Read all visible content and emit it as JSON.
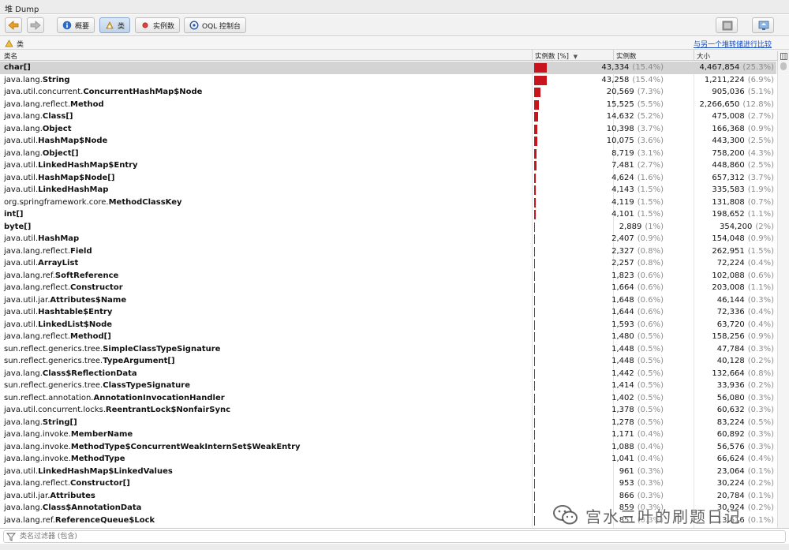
{
  "window": {
    "title": "堆 Dump"
  },
  "toolbar": {
    "buttons": [
      {
        "label": "概要"
      },
      {
        "label": "类"
      },
      {
        "label": "实例数"
      },
      {
        "label": "OQL 控制台"
      }
    ]
  },
  "panel": {
    "title": "类",
    "compare_link": "与另一个堆转储进行比较"
  },
  "table": {
    "headers": {
      "name": "类名",
      "instances_pct": "实例数 [%]",
      "instances": "实例数",
      "size": "大小"
    },
    "rows": [
      {
        "pkg": "",
        "cls": "char[]",
        "count": "43,334",
        "count_pct": "(15.4%)",
        "size": "4,467,854",
        "size_pct": "(25.3%)",
        "ratio": 1.0,
        "selected": true
      },
      {
        "pkg": "java.lang.",
        "cls": "String",
        "count": "43,258",
        "count_pct": "(15.4%)",
        "size": "1,211,224",
        "size_pct": "(6.9%)",
        "ratio": 0.998
      },
      {
        "pkg": "java.util.concurrent.",
        "cls": "ConcurrentHashMap$Node",
        "count": "20,569",
        "count_pct": "(7.3%)",
        "size": "905,036",
        "size_pct": "(5.1%)",
        "ratio": 0.475
      },
      {
        "pkg": "java.lang.reflect.",
        "cls": "Method",
        "count": "15,525",
        "count_pct": "(5.5%)",
        "size": "2,266,650",
        "size_pct": "(12.8%)",
        "ratio": 0.358
      },
      {
        "pkg": "java.lang.",
        "cls": "Class[]",
        "count": "14,632",
        "count_pct": "(5.2%)",
        "size": "475,008",
        "size_pct": "(2.7%)",
        "ratio": 0.338
      },
      {
        "pkg": "java.lang.",
        "cls": "Object",
        "count": "10,398",
        "count_pct": "(3.7%)",
        "size": "166,368",
        "size_pct": "(0.9%)",
        "ratio": 0.24
      },
      {
        "pkg": "java.util.",
        "cls": "HashMap$Node",
        "count": "10,075",
        "count_pct": "(3.6%)",
        "size": "443,300",
        "size_pct": "(2.5%)",
        "ratio": 0.232
      },
      {
        "pkg": "java.lang.",
        "cls": "Object[]",
        "count": "8,719",
        "count_pct": "(3.1%)",
        "size": "758,200",
        "size_pct": "(4.3%)",
        "ratio": 0.201
      },
      {
        "pkg": "java.util.",
        "cls": "LinkedHashMap$Entry",
        "count": "7,481",
        "count_pct": "(2.7%)",
        "size": "448,860",
        "size_pct": "(2.5%)",
        "ratio": 0.173
      },
      {
        "pkg": "java.util.",
        "cls": "HashMap$Node[]",
        "count": "4,624",
        "count_pct": "(1.6%)",
        "size": "657,312",
        "size_pct": "(3.7%)",
        "ratio": 0.107
      },
      {
        "pkg": "java.util.",
        "cls": "LinkedHashMap",
        "count": "4,143",
        "count_pct": "(1.5%)",
        "size": "335,583",
        "size_pct": "(1.9%)",
        "ratio": 0.096
      },
      {
        "pkg": "org.springframework.core.",
        "cls": "MethodClassKey",
        "count": "4,119",
        "count_pct": "(1.5%)",
        "size": "131,808",
        "size_pct": "(0.7%)",
        "ratio": 0.095
      },
      {
        "pkg": "",
        "cls": "int[]",
        "count": "4,101",
        "count_pct": "(1.5%)",
        "size": "198,652",
        "size_pct": "(1.1%)",
        "ratio": 0.095
      },
      {
        "pkg": "",
        "cls": "byte[]",
        "count": "2,889",
        "count_pct": "(1%)",
        "size": "354,200",
        "size_pct": "(2%)",
        "ratio": 0.067
      },
      {
        "pkg": "java.util.",
        "cls": "HashMap",
        "count": "2,407",
        "count_pct": "(0.9%)",
        "size": "154,048",
        "size_pct": "(0.9%)",
        "ratio": 0.056
      },
      {
        "pkg": "java.lang.reflect.",
        "cls": "Field",
        "count": "2,327",
        "count_pct": "(0.8%)",
        "size": "262,951",
        "size_pct": "(1.5%)",
        "ratio": 0.054
      },
      {
        "pkg": "java.util.",
        "cls": "ArrayList",
        "count": "2,257",
        "count_pct": "(0.8%)",
        "size": "72,224",
        "size_pct": "(0.4%)",
        "ratio": 0.052
      },
      {
        "pkg": "java.lang.ref.",
        "cls": "SoftReference",
        "count": "1,823",
        "count_pct": "(0.6%)",
        "size": "102,088",
        "size_pct": "(0.6%)",
        "ratio": 0.042
      },
      {
        "pkg": "java.lang.reflect.",
        "cls": "Constructor",
        "count": "1,664",
        "count_pct": "(0.6%)",
        "size": "203,008",
        "size_pct": "(1.1%)",
        "ratio": 0.038
      },
      {
        "pkg": "java.util.jar.",
        "cls": "Attributes$Name",
        "count": "1,648",
        "count_pct": "(0.6%)",
        "size": "46,144",
        "size_pct": "(0.3%)",
        "ratio": 0.038
      },
      {
        "pkg": "java.util.",
        "cls": "Hashtable$Entry",
        "count": "1,644",
        "count_pct": "(0.6%)",
        "size": "72,336",
        "size_pct": "(0.4%)",
        "ratio": 0.038
      },
      {
        "pkg": "java.util.",
        "cls": "LinkedList$Node",
        "count": "1,593",
        "count_pct": "(0.6%)",
        "size": "63,720",
        "size_pct": "(0.4%)",
        "ratio": 0.037
      },
      {
        "pkg": "java.lang.reflect.",
        "cls": "Method[]",
        "count": "1,480",
        "count_pct": "(0.5%)",
        "size": "158,256",
        "size_pct": "(0.9%)",
        "ratio": 0.034
      },
      {
        "pkg": "sun.reflect.generics.tree.",
        "cls": "SimpleClassTypeSignature",
        "count": "1,448",
        "count_pct": "(0.5%)",
        "size": "47,784",
        "size_pct": "(0.3%)",
        "ratio": 0.033
      },
      {
        "pkg": "sun.reflect.generics.tree.",
        "cls": "TypeArgument[]",
        "count": "1,448",
        "count_pct": "(0.5%)",
        "size": "40,128",
        "size_pct": "(0.2%)",
        "ratio": 0.033
      },
      {
        "pkg": "java.lang.",
        "cls": "Class$ReflectionData",
        "count": "1,442",
        "count_pct": "(0.5%)",
        "size": "132,664",
        "size_pct": "(0.8%)",
        "ratio": 0.033
      },
      {
        "pkg": "sun.reflect.generics.tree.",
        "cls": "ClassTypeSignature",
        "count": "1,414",
        "count_pct": "(0.5%)",
        "size": "33,936",
        "size_pct": "(0.2%)",
        "ratio": 0.033
      },
      {
        "pkg": "sun.reflect.annotation.",
        "cls": "AnnotationInvocationHandler",
        "count": "1,402",
        "count_pct": "(0.5%)",
        "size": "56,080",
        "size_pct": "(0.3%)",
        "ratio": 0.032
      },
      {
        "pkg": "java.util.concurrent.locks.",
        "cls": "ReentrantLock$NonfairSync",
        "count": "1,378",
        "count_pct": "(0.5%)",
        "size": "60,632",
        "size_pct": "(0.3%)",
        "ratio": 0.032
      },
      {
        "pkg": "java.lang.",
        "cls": "String[]",
        "count": "1,278",
        "count_pct": "(0.5%)",
        "size": "83,224",
        "size_pct": "(0.5%)",
        "ratio": 0.029
      },
      {
        "pkg": "java.lang.invoke.",
        "cls": "MemberName",
        "count": "1,171",
        "count_pct": "(0.4%)",
        "size": "60,892",
        "size_pct": "(0.3%)",
        "ratio": 0.027
      },
      {
        "pkg": "java.lang.invoke.",
        "cls": "MethodType$ConcurrentWeakInternSet$WeakEntry",
        "count": "1,088",
        "count_pct": "(0.4%)",
        "size": "56,576",
        "size_pct": "(0.3%)",
        "ratio": 0.025
      },
      {
        "pkg": "java.lang.invoke.",
        "cls": "MethodType",
        "count": "1,041",
        "count_pct": "(0.4%)",
        "size": "66,624",
        "size_pct": "(0.4%)",
        "ratio": 0.024
      },
      {
        "pkg": "java.util.",
        "cls": "LinkedHashMap$LinkedValues",
        "count": "961",
        "count_pct": "(0.3%)",
        "size": "23,064",
        "size_pct": "(0.1%)",
        "ratio": 0.022
      },
      {
        "pkg": "java.lang.reflect.",
        "cls": "Constructor[]",
        "count": "953",
        "count_pct": "(0.3%)",
        "size": "30,224",
        "size_pct": "(0.2%)",
        "ratio": 0.022
      },
      {
        "pkg": "java.util.jar.",
        "cls": "Attributes",
        "count": "866",
        "count_pct": "(0.3%)",
        "size": "20,784",
        "size_pct": "(0.1%)",
        "ratio": 0.02
      },
      {
        "pkg": "java.lang.",
        "cls": "Class$AnnotationData",
        "count": "859",
        "count_pct": "(0.3%)",
        "size": "30,924",
        "size_pct": "(0.2%)",
        "ratio": 0.02
      },
      {
        "pkg": "java.lang.ref.",
        "cls": "ReferenceQueue$Lock",
        "count": "851",
        "count_pct": "(0.3%)",
        "size": "13,616",
        "size_pct": "(0.1%)",
        "ratio": 0.02
      }
    ]
  },
  "filter": {
    "placeholder": "类名过滤器 (包含)"
  },
  "watermark": {
    "text": "宫水三叶的刷题日记"
  },
  "colors": {
    "bar": "#c8141c",
    "selected_row": "#d4d4d4",
    "link": "#1a4fbf"
  },
  "icons": [
    "back-arrow-icon",
    "forward-arrow-icon",
    "info-icon",
    "class-icon",
    "instances-icon",
    "oql-icon",
    "snapshot-icon",
    "compare-icon",
    "filter-icon",
    "wechat-icon"
  ]
}
